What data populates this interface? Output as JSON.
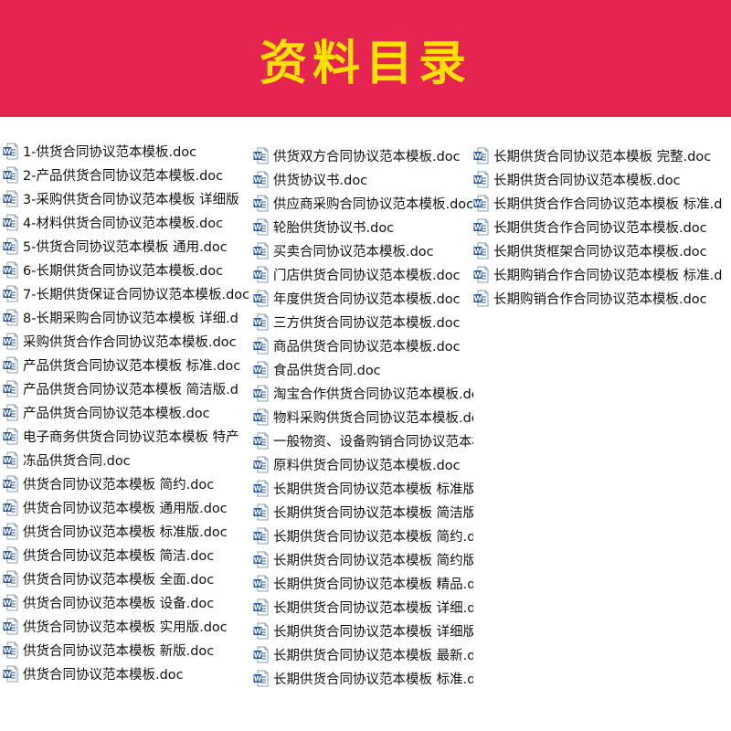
{
  "header": {
    "title": "资料目录"
  },
  "icon": "word-doc-icon",
  "colors": {
    "banner": "#e5254f",
    "title": "#ffe000",
    "icon": "#2b5797"
  },
  "columns": [
    [
      "1-供货合同协议范本模板.doc",
      "2-产品供货合同协议范本模板.doc",
      "3-采购供货合同协议范本模板  详细版",
      "4-材料供货合同协议范本模板.doc",
      "5-供货合同协议范本模板  通用.doc",
      "6-长期供货合同协议范本模板.doc",
      "7-长期供货保证合同协议范本模板.doc",
      "8-长期采购合同协议范本模板  详细.d",
      "采购供货合作合同协议范本模板.doc",
      "产品供货合同协议范本模板  标准.doc",
      "产品供货合同协议范本模板  简洁版.d",
      "产品供货合同协议范本模板.doc",
      "电子商务供货合同协议范本模板  特产",
      "冻品供货合同.doc",
      "供货合同协议范本模板   简约.doc",
      "供货合同协议范本模板   通用版.doc",
      "供货合同协议范本模板  标准版.doc",
      "供货合同协议范本模板  简洁.doc",
      "供货合同协议范本模板  全面.doc",
      "供货合同协议范本模板  设备.doc",
      "供货合同协议范本模板  实用版.doc",
      "供货合同协议范本模板  新版.doc",
      "供货合同协议范本模板.doc"
    ],
    [
      "供货双方合同协议范本模板.doc",
      "供货协议书.doc",
      "供应商采购合同协议范本模板.doc",
      "轮胎供货协议书.doc",
      "买卖合同协议范本模板.doc",
      "门店供货合同协议范本模板.doc",
      "年度供货合同协议范本模板.doc",
      "三方供货合同协议范本模板.doc",
      "商品供货合同协议范本模板.doc",
      "食品供货合同.doc",
      "淘宝合作供货合同协议范本模板.doc",
      "物料采购供货合同协议范本模板.doc",
      "一般物资、设备购销合同协议范本模板.doc",
      "原料供货合同协议范本模板.doc",
      "长期供货合同协议范本模板  标准版.doc",
      "长期供货合同协议范本模板  简洁版.doc",
      "长期供货合同协议范本模板  简约.doc",
      "长期供货合同协议范本模板  简约版.doc",
      "长期供货合同协议范本模板  精品.doc",
      "长期供货合同协议范本模板  详细.doc",
      "长期供货合同协议范本模板  详细版.doc",
      "长期供货合同协议范本模板  最新.doc",
      "长期供货合同协议范本模板 标准.doc"
    ],
    [
      "长期供货合同协议范本模板 完整.doc",
      "长期供货合同协议范本模板.doc",
      "长期供货合作合同协议范本模板 标准.d",
      "长期供货合作合同协议范本模板.doc",
      "长期供货框架合同协议范本模板.doc",
      "长期购销合作合同协议范本模板 标准.d",
      "长期购销合作合同协议范本模板.doc"
    ]
  ]
}
